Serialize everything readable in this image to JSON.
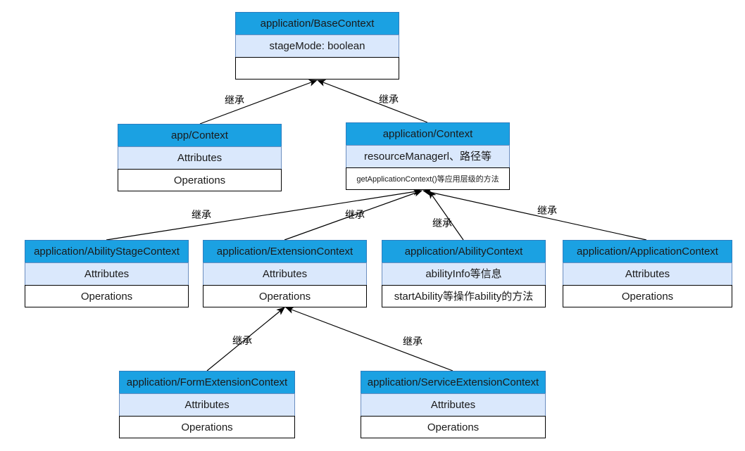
{
  "classes": {
    "base": {
      "name": "application/BaseContext",
      "attributes": "stageMode: boolean",
      "operations": ""
    },
    "app_context": {
      "name": "app/Context",
      "attributes": "Attributes",
      "operations": "Operations"
    },
    "app_context2": {
      "name": "application/Context",
      "attributes": "resourceManagerl、路径等",
      "operations": "getApplicationContext()等应用层级的方法"
    },
    "ability_stage": {
      "name": "application/AbilityStageContext",
      "attributes": "Attributes",
      "operations": "Operations"
    },
    "extension": {
      "name": "application/ExtensionContext",
      "attributes": "Attributes",
      "operations": "Operations"
    },
    "ability": {
      "name": "application/AbilityContext",
      "attributes": "abilityInfo等信息",
      "operations": "startAbility等操作ability的方法"
    },
    "application": {
      "name": "application/ApplicationContext",
      "attributes": "Attributes",
      "operations": "Operations"
    },
    "form_ext": {
      "name": "application/FormExtensionContext",
      "attributes": "Attributes",
      "operations": "Operations"
    },
    "service_ext": {
      "name": "application/ServiceExtensionContext",
      "attributes": "Attributes",
      "operations": "Operations"
    }
  },
  "edges": [
    {
      "from": "app_context",
      "to": "base",
      "label": "继承"
    },
    {
      "from": "app_context2",
      "to": "base",
      "label": "继承"
    },
    {
      "from": "ability_stage",
      "to": "app_context2",
      "label": "继承"
    },
    {
      "from": "extension",
      "to": "app_context2",
      "label": "继承"
    },
    {
      "from": "ability",
      "to": "app_context2",
      "label": "继承"
    },
    {
      "from": "application",
      "to": "app_context2",
      "label": "继承"
    },
    {
      "from": "form_ext",
      "to": "extension",
      "label": "继承"
    },
    {
      "from": "service_ext",
      "to": "extension",
      "label": "继承"
    }
  ],
  "colors": {
    "header": "#1ba1e2",
    "attributes": "#dae8fc",
    "operations": "#ffffff",
    "line": "#000000"
  }
}
